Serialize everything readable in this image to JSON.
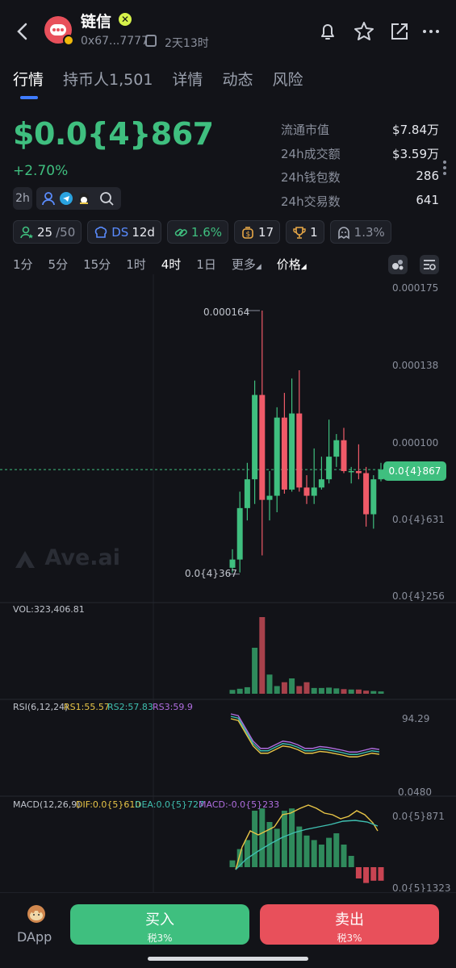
{
  "header": {
    "name": "链信",
    "verified_icon": "x-badge-icon",
    "address": "0x67...7777",
    "age": "2天13时",
    "icons": [
      "bell-icon",
      "star-icon",
      "share-icon",
      "more-icon"
    ]
  },
  "tabs": [
    {
      "label": "行情",
      "active": true
    },
    {
      "label": "持币人1,501",
      "active": false
    },
    {
      "label": "详情",
      "active": false
    },
    {
      "label": "动态",
      "active": false
    },
    {
      "label": "风险",
      "active": false
    }
  ],
  "price": {
    "value": "$0.0{4}867",
    "change": "+2.70%"
  },
  "stats": [
    {
      "label": "流通市值",
      "value": "$7.84万"
    },
    {
      "label": "24h成交额",
      "value": "$3.59万"
    },
    {
      "label": "24h钱包数",
      "value": "286"
    },
    {
      "label": "24h交易数",
      "value": "641"
    }
  ],
  "interval_badge": "2h",
  "badges": {
    "holders_top": "25",
    "holders_total": "/50",
    "ds_label": "DS",
    "ds_value": "12d",
    "badge3": "1.6%",
    "badge4": "17",
    "badge5": "1",
    "badge6": "1.3%"
  },
  "timeframes": [
    "1分",
    "5分",
    "15分",
    "1时",
    "4时",
    "1日"
  ],
  "timeframe_active": "4时",
  "more_label": "更多",
  "price_label": "价格",
  "chart_data": {
    "type": "candlestick",
    "price_axis": [
      "0.000175",
      "0.000138",
      "0.000100",
      "0.0{4}631",
      "0.0{4}256"
    ],
    "current_price_label": "0.0{4}867",
    "high_label": "0.000164",
    "low_label": "0.0{4}367",
    "watermark": "Ave.ai",
    "colors": {
      "up": "#3fbf7f",
      "down": "#ef5a68"
    },
    "candles": [
      {
        "o": 3.9e-05,
        "h": 4.8e-05,
        "l": 3.67e-05,
        "c": 4.3e-05
      },
      {
        "o": 4.3e-05,
        "h": 7.6e-05,
        "l": 3.67e-05,
        "c": 6.8e-05
      },
      {
        "o": 6.8e-05,
        "h": 9e-05,
        "l": 6.2e-05,
        "c": 8.2e-05
      },
      {
        "o": 8.2e-05,
        "h": 0.00013,
        "l": 7e-05,
        "c": 0.000123
      },
      {
        "o": 0.000123,
        "h": 0.000164,
        "l": 4.5e-05,
        "c": 7.2e-05
      },
      {
        "o": 7.2e-05,
        "h": 8.6e-05,
        "l": 6.2e-05,
        "c": 7.4e-05
      },
      {
        "o": 7.4e-05,
        "h": 0.000117,
        "l": 6.6e-05,
        "c": 0.000112
      },
      {
        "o": 0.000112,
        "h": 0.000124,
        "l": 7.5e-05,
        "c": 7.7e-05
      },
      {
        "o": 7.7e-05,
        "h": 0.000131,
        "l": 7.6e-05,
        "c": 0.000114
      },
      {
        "o": 0.000114,
        "h": 0.000135,
        "l": 7.6e-05,
        "c": 7.8e-05
      },
      {
        "o": 7.8e-05,
        "h": 8.4e-05,
        "l": 7e-05,
        "c": 7.4e-05
      },
      {
        "o": 7.4e-05,
        "h": 9.7e-05,
        "l": 7e-05,
        "c": 7.8e-05
      },
      {
        "o": 7.8e-05,
        "h": 9.3e-05,
        "l": 7.7e-05,
        "c": 8.2e-05
      },
      {
        "o": 8.2e-05,
        "h": 0.000111,
        "l": 8e-05,
        "c": 9.3e-05
      },
      {
        "o": 9.3e-05,
        "h": 0.000104,
        "l": 8.8e-05,
        "c": 0.000101
      },
      {
        "o": 0.000101,
        "h": 0.000107,
        "l": 8.5e-05,
        "c": 8.6e-05
      },
      {
        "o": 8.6e-05,
        "h": 8.8e-05,
        "l": 8e-05,
        "c": 8.6e-05
      },
      {
        "o": 8.6e-05,
        "h": 9.9e-05,
        "l": 8.2e-05,
        "c": 8.5e-05
      },
      {
        "o": 8.5e-05,
        "h": 8.8e-05,
        "l": 5.9e-05,
        "c": 6.5e-05
      },
      {
        "o": 6.5e-05,
        "h": 8.4e-05,
        "l": 5.8e-05,
        "c": 8.2e-05
      },
      {
        "o": 8.2e-05,
        "h": 9e-05,
        "l": 8.1e-05,
        "c": 8.67e-05
      }
    ],
    "volume_label": "VOL:323,406.81",
    "volume": [
      1,
      1.3,
      1.7,
      12,
      20,
      5,
      2,
      3,
      4,
      2,
      3,
      1.5,
      1.5,
      1.6,
      1.4,
      1.2,
      1.1,
      1.1,
      0.8,
      0.7,
      0.6
    ],
    "rsi_label": "RSI(6,12,24)",
    "rsi": {
      "rs1": "RS1:55.57",
      "rs2": "RS2:57.83",
      "rs3": "RS3:59.9",
      "top": "94.29",
      "bottom": "0.0480"
    },
    "macd_label": "MACD(12,26,9)",
    "macd": {
      "dif": "DIF:0.0{5}610",
      "dea": "DEA:0.0{5}727",
      "macd": "MACD:-0.0{5}233",
      "top": "0.0{5}871",
      "bottom": "0.0{5}1323"
    },
    "macd_hist": [
      0.3,
      0.8,
      1.2,
      2.5,
      2.6,
      2.0,
      1.7,
      2.5,
      2.6,
      1.8,
      1.4,
      1.2,
      1.0,
      1.3,
      1.5,
      1.0,
      0.5,
      -0.5,
      -0.7,
      -0.6,
      -0.6
    ],
    "rsi_colors": {
      "rs1": "#e8c547",
      "rs2": "#3fbfb0",
      "rs3": "#b06ee0"
    }
  },
  "bottom": {
    "dapp_label": "DApp",
    "buy_label": "买入",
    "buy_tax": "税3%",
    "sell_label": "卖出",
    "sell_tax": "税3%"
  }
}
